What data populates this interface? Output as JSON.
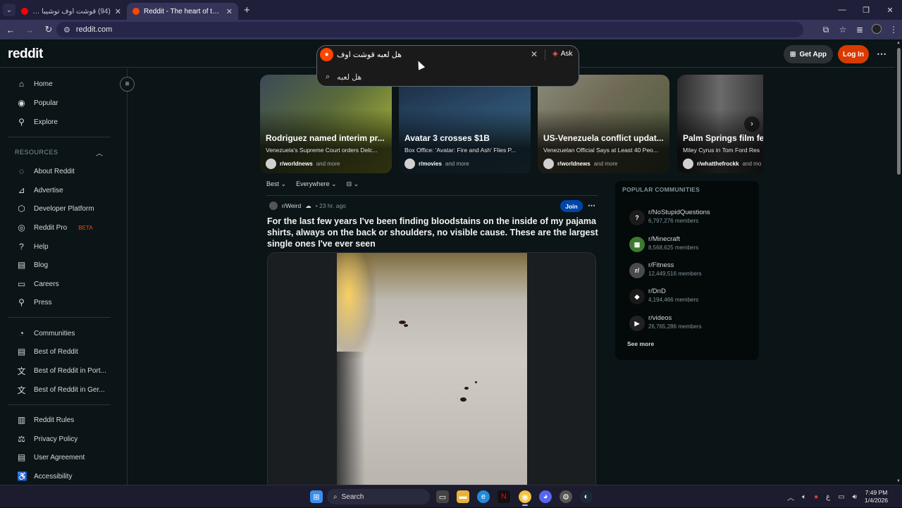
{
  "browser": {
    "tabs": [
      {
        "title": "(94) قوشت اوف توشيبا Tube 4",
        "color": "#ff0000",
        "active": false
      },
      {
        "title": "Reddit - The heart of the intern",
        "color": "#ff4500",
        "active": true
      }
    ],
    "url": "reddit.com"
  },
  "header": {
    "logo": "reddit",
    "search_value": "هل لعبه قوشت اوف",
    "ask_label": "Ask",
    "suggestion": "هل لعبه",
    "get_app": "Get App",
    "login": "Log In"
  },
  "sidebar": {
    "top": [
      {
        "label": "Home",
        "icon": "home-icon"
      },
      {
        "label": "Popular",
        "icon": "popular-icon"
      },
      {
        "label": "Explore",
        "icon": "explore-icon"
      }
    ],
    "resources_title": "RESOURCES",
    "resources": [
      {
        "label": "About Reddit"
      },
      {
        "label": "Advertise"
      },
      {
        "label": "Developer Platform"
      },
      {
        "label": "Reddit Pro",
        "badge": "BETA"
      },
      {
        "label": "Help"
      },
      {
        "label": "Blog"
      },
      {
        "label": "Careers"
      },
      {
        "label": "Press"
      }
    ],
    "more": [
      {
        "label": "Communities"
      },
      {
        "label": "Best of Reddit"
      },
      {
        "label": "Best of Reddit in Port..."
      },
      {
        "label": "Best of Reddit in Ger..."
      }
    ],
    "legal": [
      {
        "label": "Reddit Rules"
      },
      {
        "label": "Privacy Policy"
      },
      {
        "label": "User Agreement"
      },
      {
        "label": "Accessibility"
      }
    ]
  },
  "carousel": [
    {
      "title": "Rodriguez named interim pr...",
      "subtitle": "Venezuela's Supreme Court orders Delc...",
      "source": "r/worldnews",
      "more": "and more"
    },
    {
      "title": "Avatar 3 crosses $1B",
      "subtitle": "Box Office: 'Avatar: Fire and Ash' Flies P...",
      "source": "r/movies",
      "more": "and more"
    },
    {
      "title": "US-Venezuela conflict updat...",
      "subtitle": "Venezuelan Official Says at Least 40 Peo...",
      "source": "r/worldnews",
      "more": "and more"
    },
    {
      "title": "Palm Springs film fe",
      "subtitle": "Miley Cyrus in Tom Ford Res",
      "source": "r/whatthefrockk",
      "more": "and mo"
    }
  ],
  "feed": {
    "sort": "Best",
    "scope": "Everywhere"
  },
  "post": {
    "subreddit": "r/Weird",
    "time": "23 hr. ago",
    "join": "Join",
    "title": "For the last few years I've been finding bloodstains on the inside of my pajama shirts, always on the back or shoulders, no visible cause. These are the largest single ones I've ever seen"
  },
  "popular": {
    "title": "POPULAR COMMUNITIES",
    "items": [
      {
        "name": "r/NoStupidQuestions",
        "members": "6,797,276 members",
        "color": "#1c1c1c"
      },
      {
        "name": "r/Minecraft",
        "members": "8,568,625 members",
        "color": "#3e7a2e"
      },
      {
        "name": "r/Fitness",
        "members": "12,449,516 members",
        "color": "#4a4a4a"
      },
      {
        "name": "r/DnD",
        "members": "4,194,466 members",
        "color": "#1a1a1a"
      },
      {
        "name": "r/videos",
        "members": "26,765,286 members",
        "color": "#222222"
      }
    ],
    "see_more": "See more"
  },
  "taskbar": {
    "search": "Search",
    "lang": "ع",
    "time": "7:49 PM",
    "date": "1/4/2026"
  }
}
